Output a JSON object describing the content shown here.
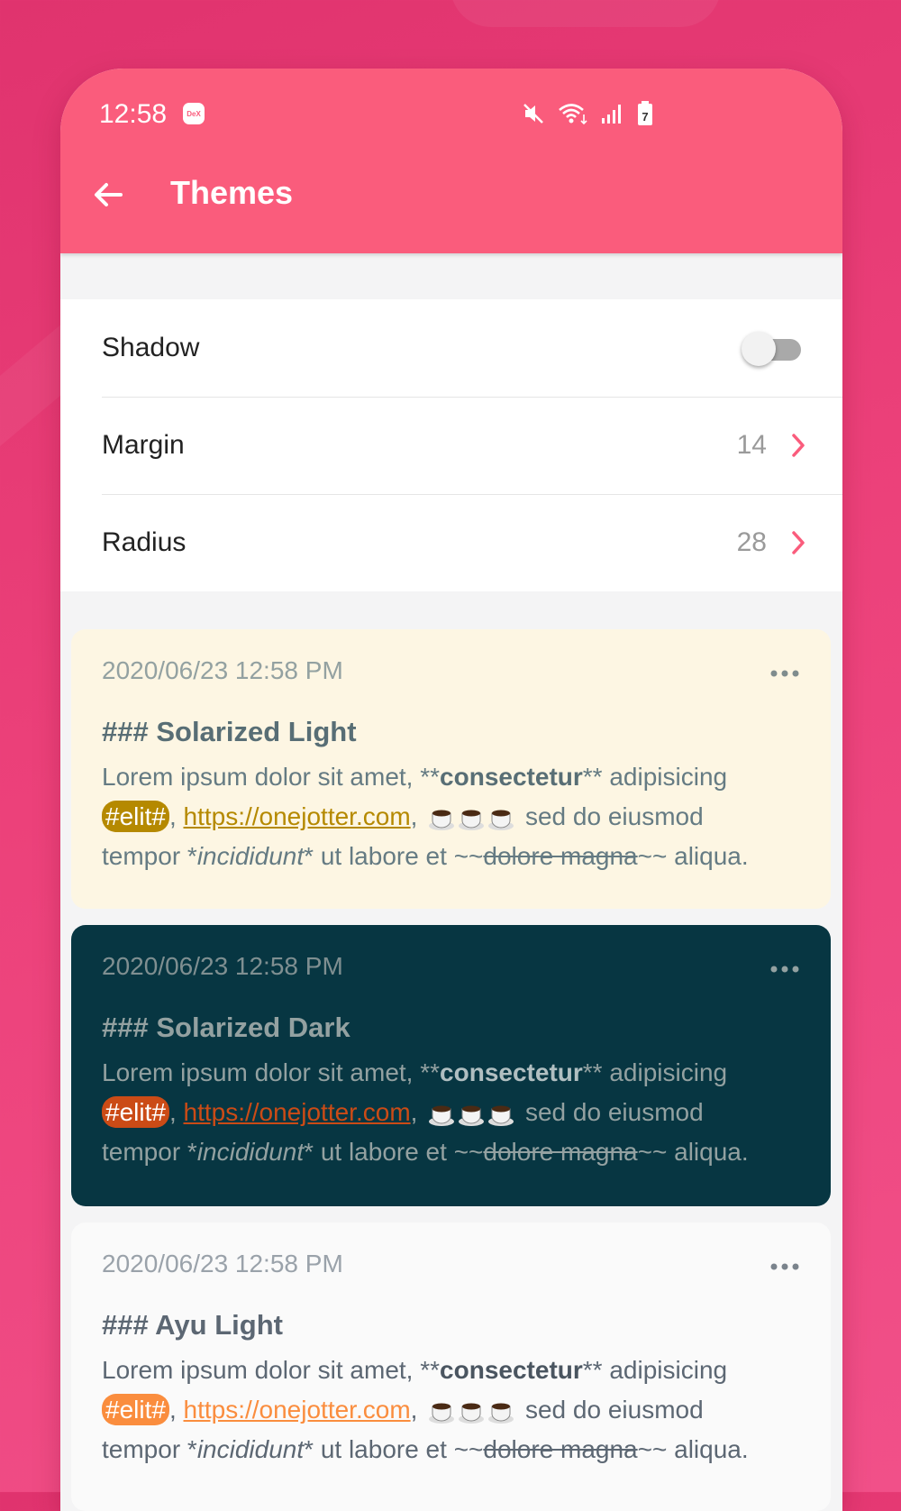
{
  "status_bar": {
    "time": "12:58",
    "dex_badge": "DeX",
    "battery": "7"
  },
  "header": {
    "title": "Themes",
    "back_icon": "arrow-left-icon",
    "color": "#fa5c7c"
  },
  "settings": {
    "shadow": {
      "label": "Shadow",
      "enabled": false
    },
    "margin": {
      "label": "Margin",
      "value": "14"
    },
    "radius": {
      "label": "Radius",
      "value": "28"
    }
  },
  "note_text": {
    "p1": "Lorem ipsum dolor sit amet, **",
    "bold": "consectetur",
    "p2": "** adipisicing",
    "tag": "#elit#",
    "comma1": ",",
    "link": "https://onejotter.com",
    "comma2": ",",
    "p3": " sed do eiusmod",
    "p4": "tempor *",
    "italic": "incididunt",
    "p5": "* ut labore et ~~",
    "strike": "dolore magna",
    "p6": "~~ aliqua."
  },
  "notes": [
    {
      "date": "2020/06/23 12:58 PM",
      "title": "### Solarized Light",
      "background": "#fdf6e3"
    },
    {
      "date": "2020/06/23 12:58 PM",
      "title": "### Solarized Dark",
      "background": "#073642"
    },
    {
      "date": "2020/06/23 12:58 PM",
      "title": "### Ayu Light",
      "background": "#fafafa"
    }
  ]
}
